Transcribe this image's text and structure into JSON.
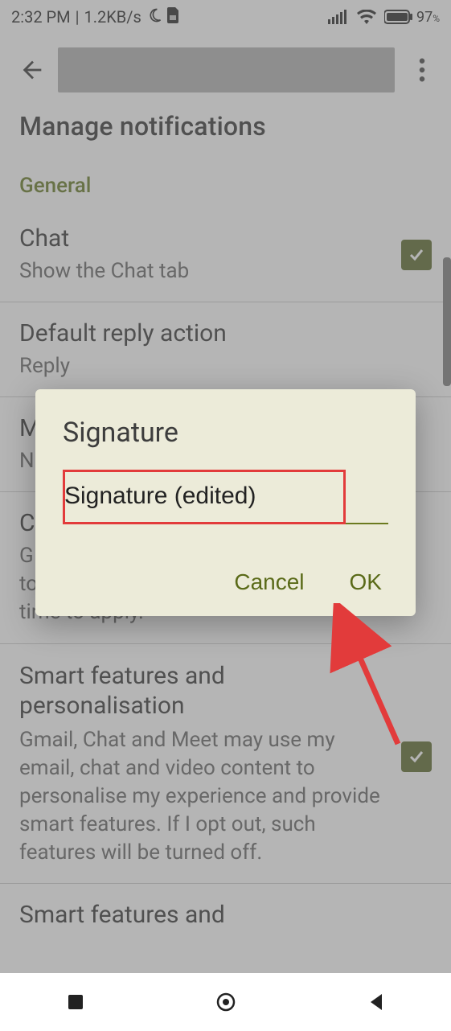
{
  "status": {
    "time": "2:32 PM",
    "net_speed": "1.2KB/s",
    "battery_pct": "97",
    "battery_pct_suffix": "%"
  },
  "appbar": {
    "back_icon": "arrow-back"
  },
  "truncated_top": "Manage notifications",
  "section_general": "General",
  "items": {
    "chat": {
      "title": "Chat",
      "sub": "Show the Chat tab"
    },
    "reply": {
      "title": "Default reply action",
      "sub": "Reply"
    },
    "m_partial": {
      "title": "M",
      "sub": "N"
    },
    "c_partial": {
      "title": "C",
      "sub_line1": "G",
      "sub_rest": "together. This setting may take some time to apply."
    },
    "smart": {
      "title": "Smart features and personalisation",
      "sub": "Gmail, Chat and Meet may use my email, chat and video content to personalise my experience and provide smart features. If I opt out, such features will be turned off."
    },
    "bottom_partial": "Smart features and"
  },
  "dialog": {
    "title": "Signature",
    "input_value": "Signature (edited)",
    "cancel": "Cancel",
    "ok": "OK"
  }
}
